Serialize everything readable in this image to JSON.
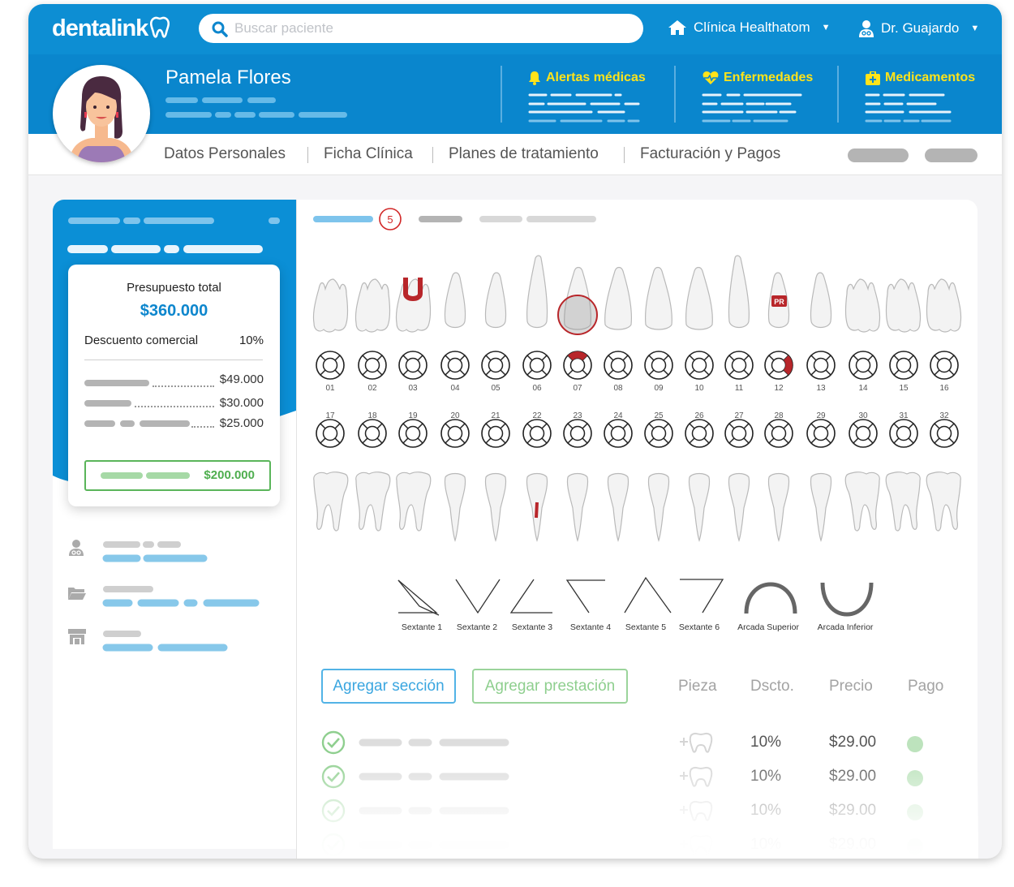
{
  "app": {
    "logo": "dentalink",
    "brand_color": "#0d8ed3",
    "accent_yellow": "#ffe31a",
    "success_green": "#5ab55a"
  },
  "search": {
    "placeholder": "Buscar paciente",
    "icon": "search-icon"
  },
  "clinic": {
    "label": "Clínica Healthatom",
    "icon": "home-icon"
  },
  "user": {
    "label": "Dr. Guajardo",
    "icon": "doctor-icon"
  },
  "patient": {
    "name": "Pamela Flores"
  },
  "alerts": [
    {
      "label": "Alertas médicas",
      "icon": "bell-icon"
    },
    {
      "label": "Enfermedades",
      "icon": "heart-pulse-icon"
    },
    {
      "label": "Medicamentos",
      "icon": "medkit-icon"
    }
  ],
  "tabs": [
    "Datos Personales",
    "Ficha Clínica",
    "Planes de tratamiento",
    "Facturación y Pagos"
  ],
  "budget": {
    "title": "Presupuesto total",
    "total": "$360.000",
    "discount_label": "Descuento comercial",
    "discount_value": "10%",
    "lines": [
      "$49.000",
      "$30.000",
      "$25.000"
    ],
    "paid": "$200.000"
  },
  "odontogram": {
    "badge": "5",
    "upper_numbers": [
      "01",
      "02",
      "03",
      "04",
      "05",
      "06",
      "07",
      "08",
      "09",
      "10",
      "11",
      "12",
      "13",
      "14",
      "15",
      "16"
    ],
    "lower_numbers": [
      "17",
      "18",
      "19",
      "20",
      "21",
      "22",
      "23",
      "24",
      "25",
      "26",
      "27",
      "28",
      "29",
      "30",
      "31",
      "32"
    ],
    "pr_label": "PR",
    "marked_color": "#b8262a"
  },
  "selectors": [
    "Sextante 1",
    "Sextante 2",
    "Sextante 3",
    "Sextante 4",
    "Sextante 5",
    "Sextante 6",
    "Arcada Superior",
    "Arcada Inferior"
  ],
  "actions": {
    "add_section": "Agregar sección",
    "add_service": "Agregar prestación"
  },
  "columns": {
    "piece": "Pieza",
    "discount": "Dscto.",
    "price": "Precio",
    "payment": "Pago"
  },
  "services": [
    {
      "discount": "10%",
      "price": "$29.00"
    },
    {
      "discount": "10%",
      "price": "$29.00"
    },
    {
      "discount": "10%",
      "price": "$29.00"
    },
    {
      "discount": "10%",
      "price": "$29.00"
    }
  ]
}
